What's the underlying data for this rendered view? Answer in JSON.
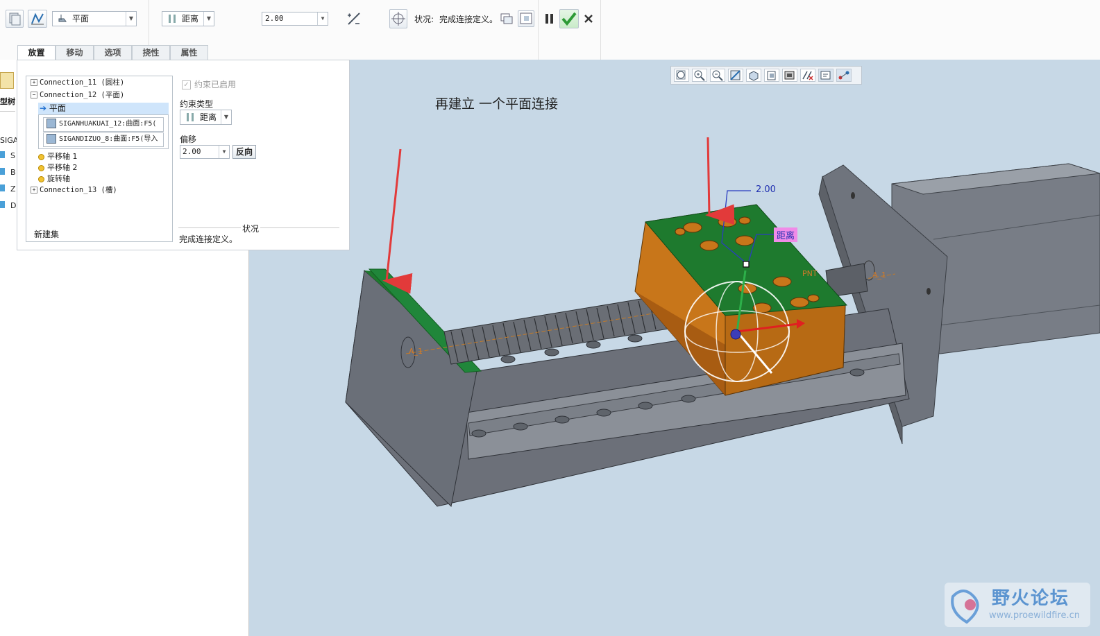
{
  "ribbon": {
    "plane_dropdown": "平面",
    "constraint_dropdown": "距离",
    "offset_value": "2.00",
    "status_label": "状况:",
    "status_text": "完成连接定义。"
  },
  "tabs": [
    "放置",
    "移动",
    "选项",
    "挠性",
    "属性"
  ],
  "tree": {
    "connection11": "Connection_11 (圆柱)",
    "connection12": "Connection_12 (平面)",
    "plane": "平面",
    "ref1": "SIGANHUAKUAI_12:曲面:F5(",
    "ref2": "SIGANDIZUO_8:曲面:F5(导入",
    "axis1": "平移轴 1",
    "axis2": "平移轴 2",
    "rot_axis": "旋转轴",
    "connection13": "Connection_13 (槽)",
    "new_set": "新建集"
  },
  "constraint": {
    "enabled_label": "约束已启用",
    "type_label": "约束类型",
    "type_value": "距离",
    "offset_label": "偏移",
    "offset_value": "2.00",
    "flip_button": "反向",
    "status_heading": "状况",
    "status_text": "完成连接定义。"
  },
  "left_strip": {
    "model_tree_label": "型树",
    "model_root": "SIGA",
    "items": [
      "S",
      "B",
      "Z",
      "D"
    ]
  },
  "viewport": {
    "annotation": "再建立 一个平面连接",
    "dim_value": "2.00",
    "dim_tag": "距离",
    "label_pnt": "PNT",
    "label_a1_left": "A_1",
    "label_a1_right": "A_1"
  },
  "watermark": {
    "title": "野火论坛",
    "url": "www.proewildfire.cn"
  },
  "colors": {
    "viewport_bg": "#c7d8e6",
    "selected_surface": "#1e7a2e",
    "slider_block": "#c8761a",
    "check_green": "#3aa845",
    "arrow_red": "#e23a3a"
  }
}
